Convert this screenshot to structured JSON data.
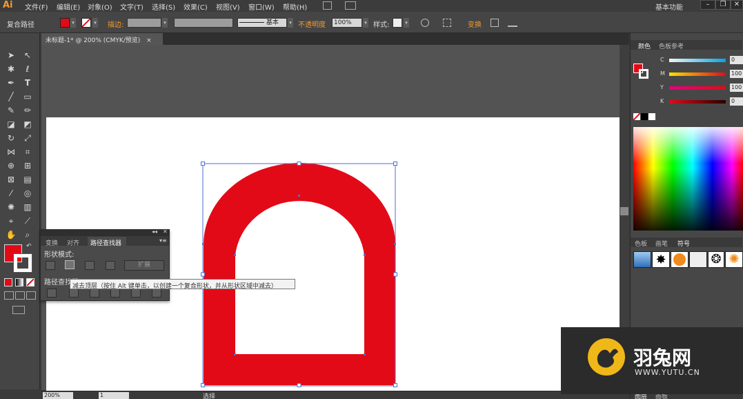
{
  "app": {
    "logo": "Ai"
  },
  "menu": [
    "文件(F)",
    "编辑(E)",
    "对象(O)",
    "文字(T)",
    "选择(S)",
    "效果(C)",
    "视图(V)",
    "窗口(W)",
    "帮助(H)"
  ],
  "workspace": "基本功能",
  "control_bar": {
    "selection_label": "复合路径",
    "stroke_label": "描边:",
    "stroke_profile": "基本",
    "opacity_label": "不透明度",
    "opacity_value": "100%",
    "style_label": "样式:",
    "transform_label": "变换"
  },
  "document_tab": {
    "title": "未标题-1* @ 200% (CMYK/预览)",
    "close": "×"
  },
  "status_bar": {
    "zoom": "200%",
    "page": "1",
    "tool": "选择"
  },
  "pathfinder": {
    "tabs": [
      "变换",
      "对齐",
      "路径查找器"
    ],
    "shape_modes_label": "形状模式:",
    "expand_label": "扩展",
    "pathfinders_label": "路径查找器:"
  },
  "tooltip": "减去顶层（按住 Alt 键单击，以创建一个复合形状，并从形状区域中减去）",
  "color_panel": {
    "tabs": [
      "颜色",
      "色板参考"
    ],
    "channels": [
      {
        "label": "C",
        "value": "0"
      },
      {
        "label": "M",
        "value": "100"
      },
      {
        "label": "Y",
        "value": "100"
      },
      {
        "label": "K",
        "value": "0"
      }
    ]
  },
  "swatch_panel": {
    "tabs": [
      "色板",
      "画笔",
      "符号"
    ]
  },
  "layers_panel": {
    "tabs": [
      "图层",
      "画板"
    ]
  },
  "watermark": {
    "name": "羽兔网",
    "url": "WWW.YUTU.CN"
  },
  "colors": {
    "fill": "#e30a17",
    "accent": "#f29a2e",
    "selection": "#4a6fd0"
  }
}
